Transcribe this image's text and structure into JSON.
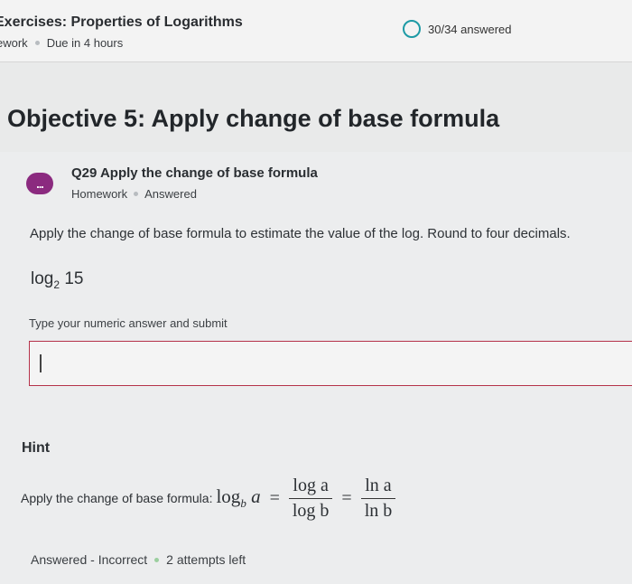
{
  "header": {
    "title": "Exercises: Properties of Logarithms",
    "type_label": "ework",
    "due": "Due in 4 hours",
    "progress": "30/34 answered"
  },
  "objective": "Objective 5: Apply change of base formula",
  "question": {
    "badge": "...",
    "title": "Q29 Apply the change of base formula",
    "type": "Homework",
    "state": "Answered",
    "instructions": "Apply the change of base formula to estimate the value of the log. Round to four decimals.",
    "expr_fn": "log",
    "expr_base": "2",
    "expr_arg": "15",
    "input_prompt": "Type your numeric answer and submit",
    "input_value": ""
  },
  "hint": {
    "label": "Hint",
    "text": "Apply the change of base formula:",
    "lead_fn": "log",
    "lead_base": "b",
    "lead_arg": "a",
    "num1": "log a",
    "den1": "log b",
    "num2": "ln a",
    "den2": "ln b"
  },
  "status": {
    "result": "Answered - Incorrect",
    "attempts": "2 attempts left"
  },
  "colors": {
    "accent_teal": "#1d9aa5",
    "badge_purple": "#8b2a7f",
    "input_border": "#b5324a"
  }
}
